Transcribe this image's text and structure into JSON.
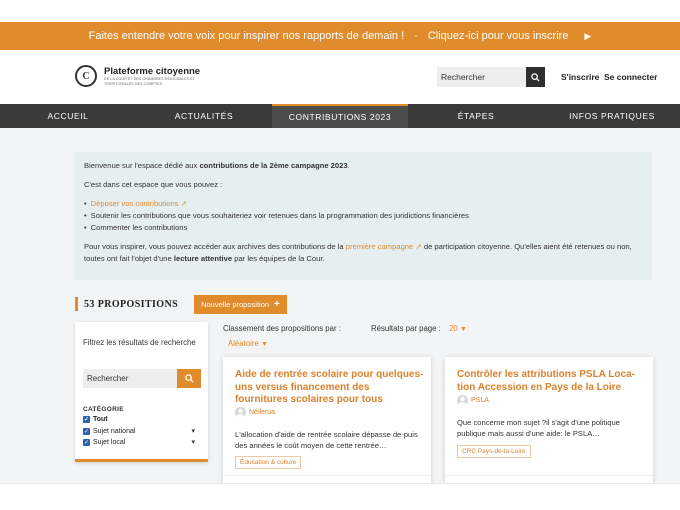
{
  "banner": {
    "text": "Faites entendre votre voix pour inspirer nos rapports de demain !",
    "separator": "-",
    "cta": "Cliquez-ici pour vous inscrire"
  },
  "header": {
    "brand_name": "Plateforme citoyenne",
    "brand_sub": "DE LA COUR ET DES CHAMBRES RÉGIONALES ET TERRITORIALES DES COMPTES",
    "search_placeholder": "Rechercher",
    "signup": "S'inscrire",
    "login": "Se connecter"
  },
  "nav": {
    "items": [
      {
        "label": "ACCUEIL"
      },
      {
        "label": "ACTUALITÉS"
      },
      {
        "label": "CONTRIBUTIONS 2023"
      },
      {
        "label": "ÉTAPES"
      },
      {
        "label": "INFOS PRATIQUES"
      }
    ]
  },
  "info": {
    "welcome_pre": "Bienvenue sur l'espace dédié aux ",
    "welcome_bold": "contributions de la 2ème campagne 2023",
    "welcome_post": ".",
    "intro": "C'est dans cet espace que vous pouvez :",
    "bullet1": "Déposer vos contributions",
    "bullet2": "Soutenir les contributions que vous souhaiteriez voir retenues dans la programmation des juridictions financières",
    "bullet3": "Commenter les contributions",
    "archive_pre": "Pour vous inspirer, vous pouvez accéder aux archives des contributions de la ",
    "archive_link": "première campagne",
    "archive_mid": " de participation citoyenne. Qu'elles aient été retenues ou non, toutes ont fait l'objet d'une ",
    "archive_bold": "lecture attentive",
    "archive_post": " par les équipes de la Cour."
  },
  "proposals": {
    "count": "53 PROPOSITIONS",
    "new_button": "Nouvelle proposition"
  },
  "filters": {
    "title": "Filtrez les résultats de recherche",
    "search_placeholder": "Rechercher",
    "category_label": "CATÉGORIE",
    "options": [
      {
        "label": "Tout"
      },
      {
        "label": "Sujet national"
      },
      {
        "label": "Sujet local"
      }
    ]
  },
  "sort": {
    "label": "Classement des propositions par :",
    "value": "Aléatoire"
  },
  "perpage": {
    "label": "Résultats par page :",
    "value": "20"
  },
  "cards": [
    {
      "title": "Aide de rentrée scolaire pour quelques-uns versus financement des fournitures scolaires pour tous",
      "author": "Néilerua",
      "excerpt": "L'allocation d'aide de rentrée scolaire dépasse de-puis des années le coût moyen de cette rentrée…",
      "tag": "Éducation & culture"
    },
    {
      "title": "Contrôler les attributions PSLA Loca-tion Accession en Pays de la Loire",
      "author": "PSLA",
      "excerpt": "Que concerne mon sujet ?il s'agit d'une politique publique mais aussi d'une aide: le PSLA…",
      "tag": "CRC Pays-de-la-Loire"
    }
  ],
  "colors": {
    "accent": "#e08b2c",
    "nav_bg": "#3a3a3a",
    "info_bg": "#e5eff2"
  }
}
